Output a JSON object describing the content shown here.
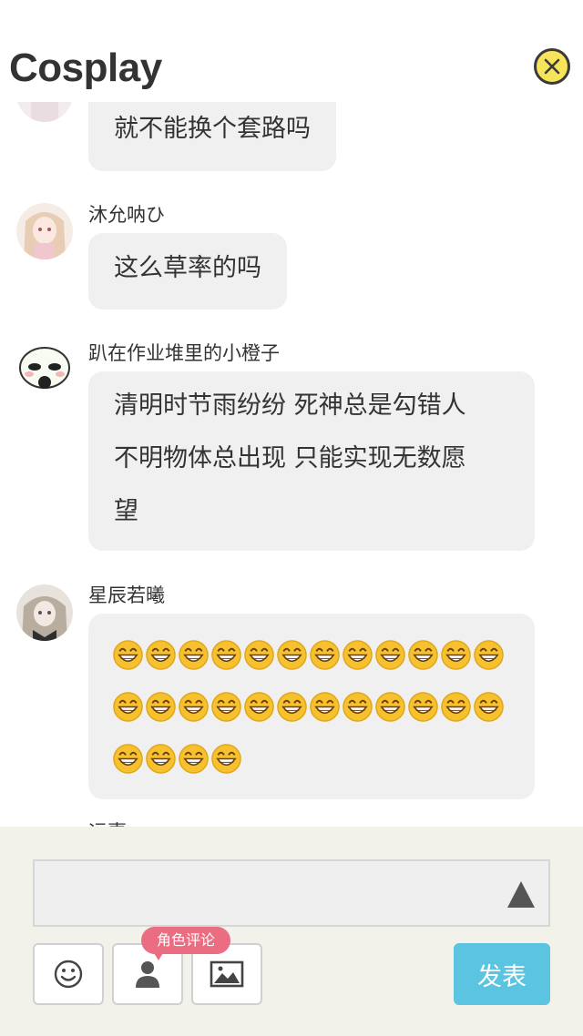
{
  "header": {
    "title": "Cosplay",
    "close_icon": "close-icon"
  },
  "messages": [
    {
      "id": "m1",
      "user": "",
      "text": "就不能换个套路吗"
    },
    {
      "id": "m2",
      "user": "沐允呐ひ",
      "text": "这么草率的吗"
    },
    {
      "id": "m3",
      "user": "趴在作业堆里的小橙子",
      "lines": [
        "清明时节雨纷纷 死神总是勾错人",
        "不明物体总出现 只能实现无数愿",
        "望"
      ]
    },
    {
      "id": "m4",
      "user": "星辰若曦",
      "emoji": {
        "name": "grin-emoji",
        "rows": [
          12,
          12,
          4
        ]
      }
    }
  ],
  "next_user_partial": "远嘉",
  "composer": {
    "input_value": "",
    "send_icon": "triangle-up-icon",
    "role_comment_label": "角色评论",
    "publish_label": "发表",
    "accent_colors": {
      "publish": "#5bc4e0",
      "badge": "#ea6d82",
      "close": "#f7e45a"
    }
  }
}
